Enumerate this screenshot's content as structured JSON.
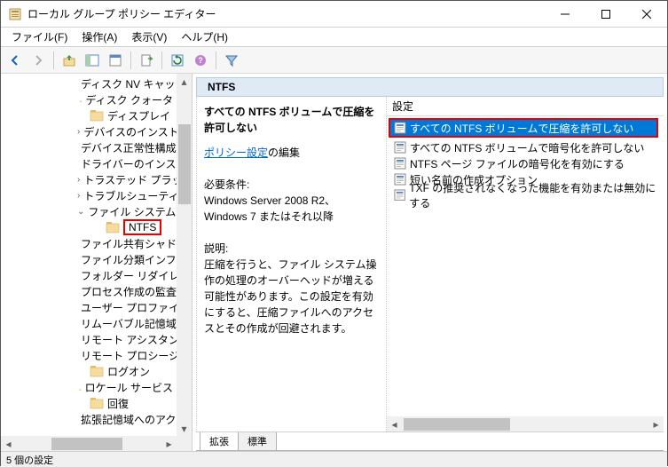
{
  "window": {
    "title": "ローカル グループ ポリシー エディター"
  },
  "menu": {
    "file": "ファイル(F)",
    "action": "操作(A)",
    "view": "表示(V)",
    "help": "ヘルプ(H)"
  },
  "tree": {
    "indent_base": 86,
    "items": [
      {
        "label": "ディスク NV キャッシュ",
        "expander": ""
      },
      {
        "label": "ディスク クォータ",
        "expander": ""
      },
      {
        "label": "ディスプレイ",
        "expander": ""
      },
      {
        "label": "デバイスのインストール",
        "expander": ">"
      },
      {
        "label": "デバイス正常性構成",
        "expander": ""
      },
      {
        "label": "ドライバーのインストー",
        "expander": ""
      },
      {
        "label": "トラステッド プラットフ",
        "expander": ">"
      },
      {
        "label": "トラブルシューティング",
        "expander": ">"
      },
      {
        "label": "ファイル システム",
        "expander": "v",
        "open": true
      },
      {
        "label": "NTFS",
        "expander": "",
        "selected": true,
        "childIndent": 18
      },
      {
        "label": "ファイル共有シャドウ コ",
        "expander": ""
      },
      {
        "label": "ファイル分類インフラス",
        "expander": ""
      },
      {
        "label": "フォルダー リダイレクト",
        "expander": ""
      },
      {
        "label": "プロセス作成の監査",
        "expander": ""
      },
      {
        "label": "ユーザー プロファイル",
        "expander": ""
      },
      {
        "label": "リムーバブル記憶域へ",
        "expander": ""
      },
      {
        "label": "リモート アシスタンス",
        "expander": ""
      },
      {
        "label": "リモート プロシージャ コ",
        "expander": ""
      },
      {
        "label": "ログオン",
        "expander": ""
      },
      {
        "label": "ロケール サービス",
        "expander": ""
      },
      {
        "label": "回復",
        "expander": ""
      },
      {
        "label": "拡張記憶域へのアクセ",
        "expander": ""
      }
    ]
  },
  "right": {
    "header": "NTFS",
    "desc": {
      "title": "すべての NTFS ボリュームで圧縮を許可しない",
      "link_label": "ポリシー設定",
      "link_suffix": "の編集",
      "req_label": "必要条件:",
      "req_value": "Windows Server 2008 R2、Windows 7 またはそれ以降",
      "explain_label": "説明:",
      "explain_body": "圧縮を行うと、ファイル システム操作の処理のオーバーヘッドが増える可能性があります。この設定を有効にすると、圧縮ファイルへのアクセスとその作成が回避されます。"
    },
    "list": {
      "column": "設定",
      "items": [
        {
          "label": "すべての NTFS ボリュームで圧縮を許可しない",
          "selected": true
        },
        {
          "label": "すべての NTFS ボリュームで暗号化を許可しない"
        },
        {
          "label": "NTFS ページ ファイルの暗号化を有効にする"
        },
        {
          "label": "短い名前の作成オプション"
        },
        {
          "label": "TXF の推奨されなくなった機能を有効または無効にする"
        }
      ]
    },
    "tabs": {
      "extended": "拡張",
      "standard": "標準"
    }
  },
  "status": "5 個の設定"
}
